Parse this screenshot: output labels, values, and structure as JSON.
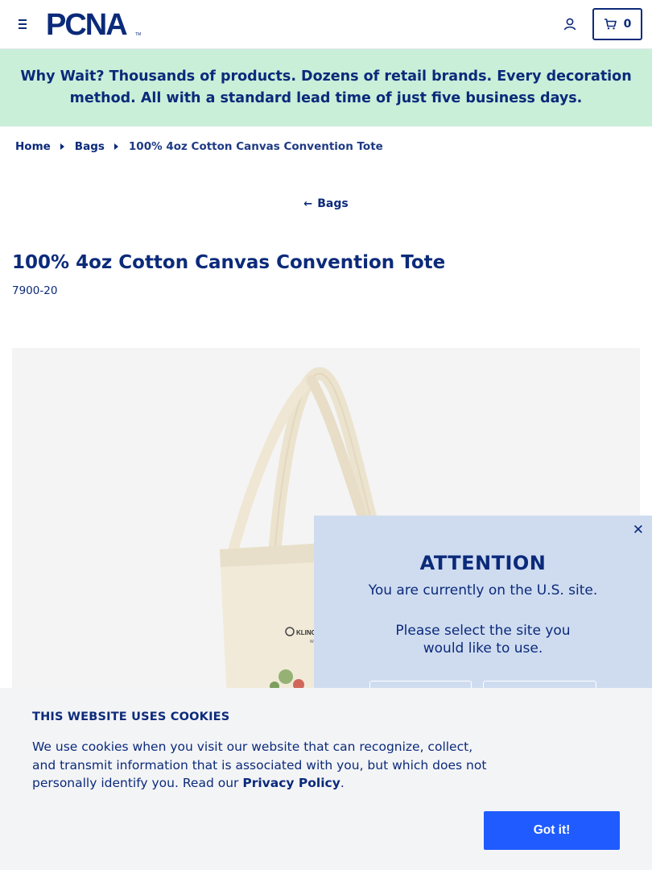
{
  "header": {
    "logo_text": "PCNA",
    "cart_count": "0"
  },
  "promo": {
    "lead": "Why Wait?",
    "text": " Thousands of products. Dozens of retail brands. Every decoration method. All with a standard lead time of just five business days."
  },
  "breadcrumb": {
    "home": "Home",
    "category": "Bags",
    "current": "100% 4oz Cotton Canvas Convention Tote"
  },
  "back_link": {
    "label": "Bags"
  },
  "product": {
    "title": "100% 4oz Cotton Canvas Convention Tote",
    "sku": "7900-20",
    "print_text": "KLING"
  },
  "site_modal": {
    "title": "ATTENTION",
    "line1": "You are currently on the U.S. site.",
    "line2": "Please select the site you would like to use."
  },
  "cookie": {
    "title": "THIS WEBSITE USES COOKIES",
    "text_before": "We use cookies when you visit our website that can recognize, collect, and transmit information that is associated with you, but which does not personally identify you. Read our ",
    "link": "Privacy Policy",
    "text_after": ".",
    "button": "Got it!"
  },
  "colors": {
    "brand_navy": "#0b2a7a",
    "promo_bg": "#c9efd9",
    "modal_bg": "#cfdcf0",
    "button_blue": "#1f5bff"
  },
  "icons": [
    "menu-icon",
    "account-icon",
    "cart-icon",
    "arrow-left-icon",
    "close-icon",
    "caret-right-icon"
  ]
}
